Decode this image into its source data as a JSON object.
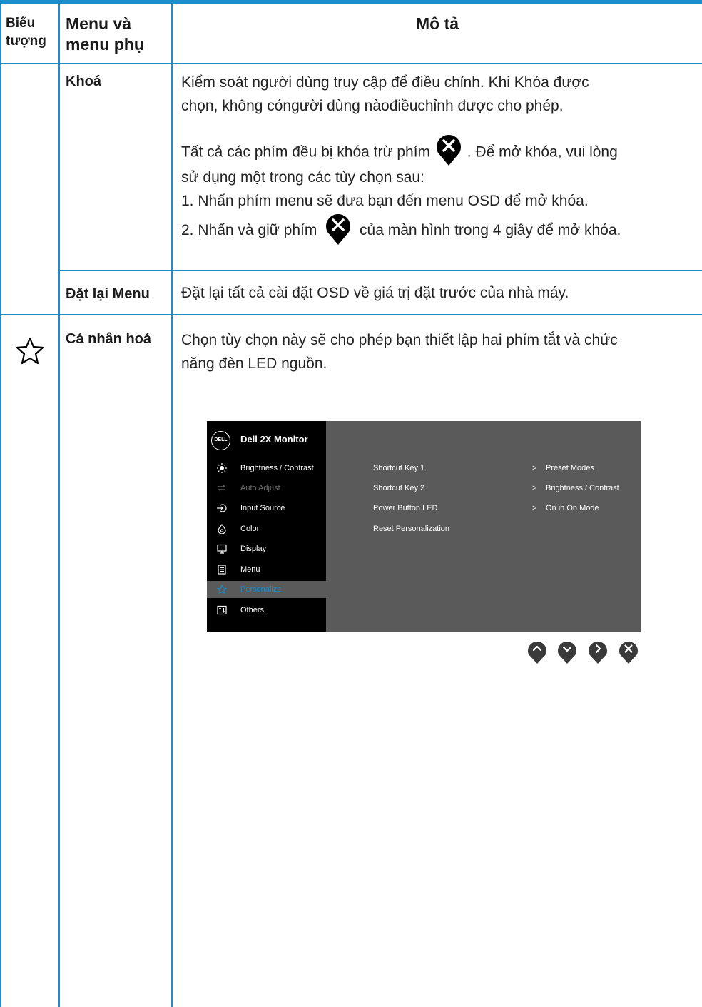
{
  "header": {
    "col1_line1": "Biểu",
    "col1_line2": "tượng",
    "col2_line1": "Menu và",
    "col2_line2": "menu phụ",
    "col3": "Mô tả"
  },
  "rows": {
    "lock": {
      "name": "Khoá",
      "desc_line1": "Kiểm soát người dùng truy cập để điều chỉnh. Khi Khóa được",
      "desc_line2": "chọn, không cóngười dùng nàođiềuchỉnh được cho phép.",
      "para2_pre": "Tất cả các phím đều bị khóa trừ phím",
      "para2_post": ". Để mở khóa, vui lòng",
      "para2_line2": "sử dụng một trong các tùy chọn sau:",
      "option1": "1.  Nhấn phím menu sẽ đưa bạn đến menu OSD để mở khóa.",
      "option2_pre": "2.  Nhấn và giữ phím",
      "option2_post": "của màn hình trong 4 giây để mở khóa."
    },
    "reset": {
      "name": "Đặt lại Menu",
      "desc": "Đặt lại tất cả cài đặt OSD về giá trị đặt trước của nhà máy."
    },
    "personalize": {
      "icon": "star-icon",
      "name": "Cá nhân hoá",
      "desc_line1": "Chọn tùy chọn này sẽ cho phép bạn thiết lập hai phím tắt và chức",
      "desc_line2": "năng đèn LED nguồn."
    }
  },
  "osd": {
    "logo": "DELL",
    "title": "Dell 2X Monitor",
    "menu": [
      {
        "label": "Brightness / Contrast",
        "icon": "brightness-icon"
      },
      {
        "label": "Auto Adjust",
        "icon": "auto-adjust-icon"
      },
      {
        "label": "Input Source",
        "icon": "input-source-icon"
      },
      {
        "label": "Color",
        "icon": "color-icon"
      },
      {
        "label": "Display",
        "icon": "display-icon"
      },
      {
        "label": "Menu",
        "icon": "menu-icon"
      },
      {
        "label": "Personalize",
        "icon": "star-icon"
      },
      {
        "label": "Others",
        "icon": "others-icon"
      }
    ],
    "options": [
      "Shortcut Key 1",
      "Shortcut Key 2",
      "Power Button LED",
      "Reset Personalization"
    ],
    "values": [
      "Preset Modes",
      "Brightness / Contrast",
      "On in On Mode"
    ],
    "arrow": ">",
    "buttons": [
      "up-button",
      "down-button",
      "right-button",
      "close-button"
    ]
  },
  "colors": {
    "accent": "#1a8fd0",
    "osd_panel": "#5a5a5a",
    "osd_sidebar": "#000000"
  }
}
